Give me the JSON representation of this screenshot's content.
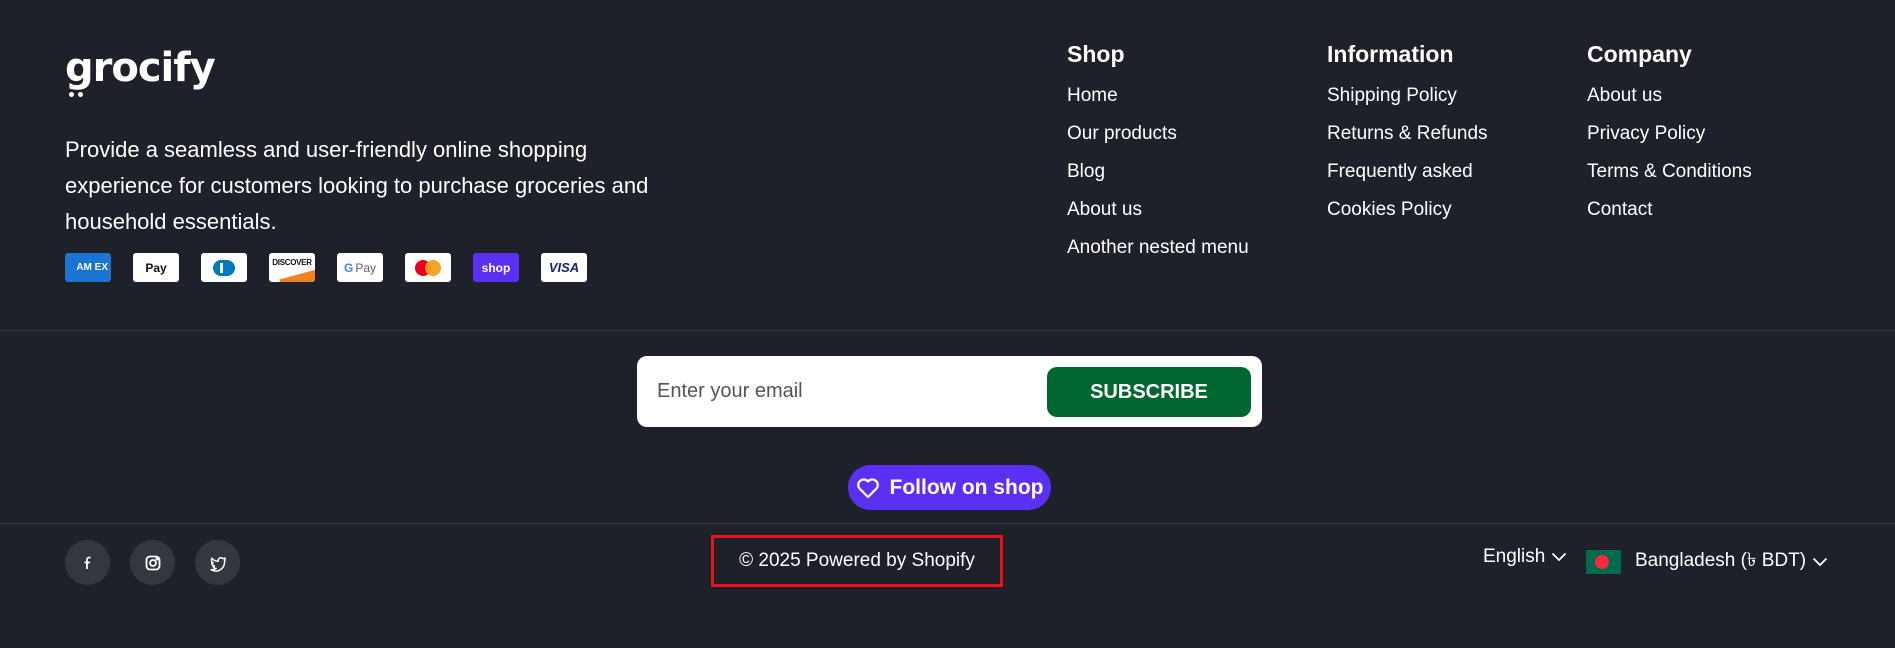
{
  "brand": {
    "logo_text": "grocify",
    "description": "Provide a seamless and user-friendly online shopping experience for customers looking to purchase groceries and household essentials."
  },
  "payment_methods": [
    {
      "name": "American Express",
      "label": "AM EX"
    },
    {
      "name": "Apple Pay",
      "label": " Pay"
    },
    {
      "name": "Diners Club",
      "label": ""
    },
    {
      "name": "Discover",
      "label": "DISCOVER"
    },
    {
      "name": "Google Pay",
      "label_g": "G",
      "label_text": "Pay"
    },
    {
      "name": "Mastercard",
      "label": ""
    },
    {
      "name": "Shop Pay",
      "label": "shop"
    },
    {
      "name": "Visa",
      "label": "VISA"
    }
  ],
  "menus": {
    "shop": {
      "title": "Shop",
      "items": [
        "Home",
        "Our products",
        "Blog",
        "About us",
        "Another nested menu"
      ]
    },
    "information": {
      "title": "Information",
      "items": [
        "Shipping Policy",
        "Returns & Refunds",
        "Frequently asked",
        "Cookies Policy"
      ]
    },
    "company": {
      "title": "Company",
      "items": [
        "About us",
        "Privacy Policy",
        "Terms & Conditions",
        "Contact"
      ]
    }
  },
  "newsletter": {
    "placeholder": "Enter your email",
    "value": "",
    "button_label": "SUBSCRIBE"
  },
  "follow": {
    "label": "Follow on shop",
    "icon": "heart-icon"
  },
  "socials": [
    {
      "name": "facebook",
      "icon": "facebook-icon"
    },
    {
      "name": "instagram",
      "icon": "instagram-icon"
    },
    {
      "name": "twitter",
      "icon": "twitter-icon"
    }
  ],
  "copyright": "© 2025 Powered by Shopify",
  "locale": {
    "language": "English",
    "country": "Bangladesh (৳ BDT)"
  },
  "colors": {
    "background": "#1f212a",
    "subscribe_button": "#006730",
    "shop_purple": "#5a31f4",
    "highlight_border": "#e3161d"
  }
}
